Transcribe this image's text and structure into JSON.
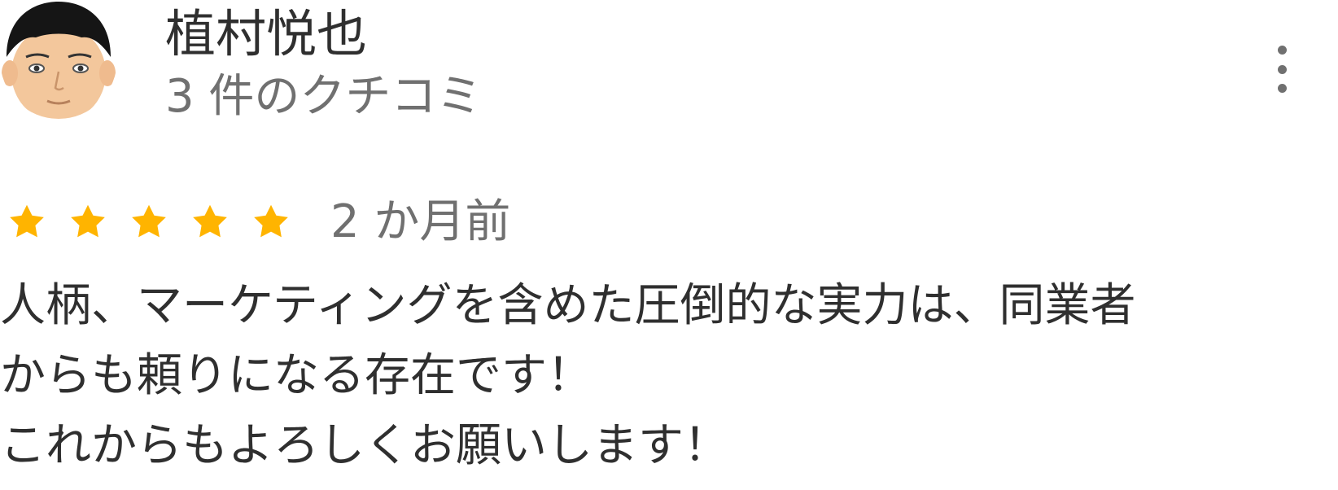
{
  "reviewer": {
    "name": "植村悦也",
    "review_count": "3 件のクチコミ",
    "avatar_icon": "avatar-face-icon"
  },
  "menu": {
    "icon": "more-vertical-icon"
  },
  "rating": {
    "stars": 5,
    "max_stars": 5,
    "star_color": "#FFB400",
    "date": "2 か月前"
  },
  "review": {
    "lines": [
      "人柄、マーケティングを含めた圧倒的な実力は、同業者",
      "からも頼りになる存在です！",
      "これからもよろしくお願いします！"
    ]
  },
  "colors": {
    "name_text": "#2f2f2f",
    "secondary_text": "#707070",
    "body_text": "#2f2f2f"
  }
}
